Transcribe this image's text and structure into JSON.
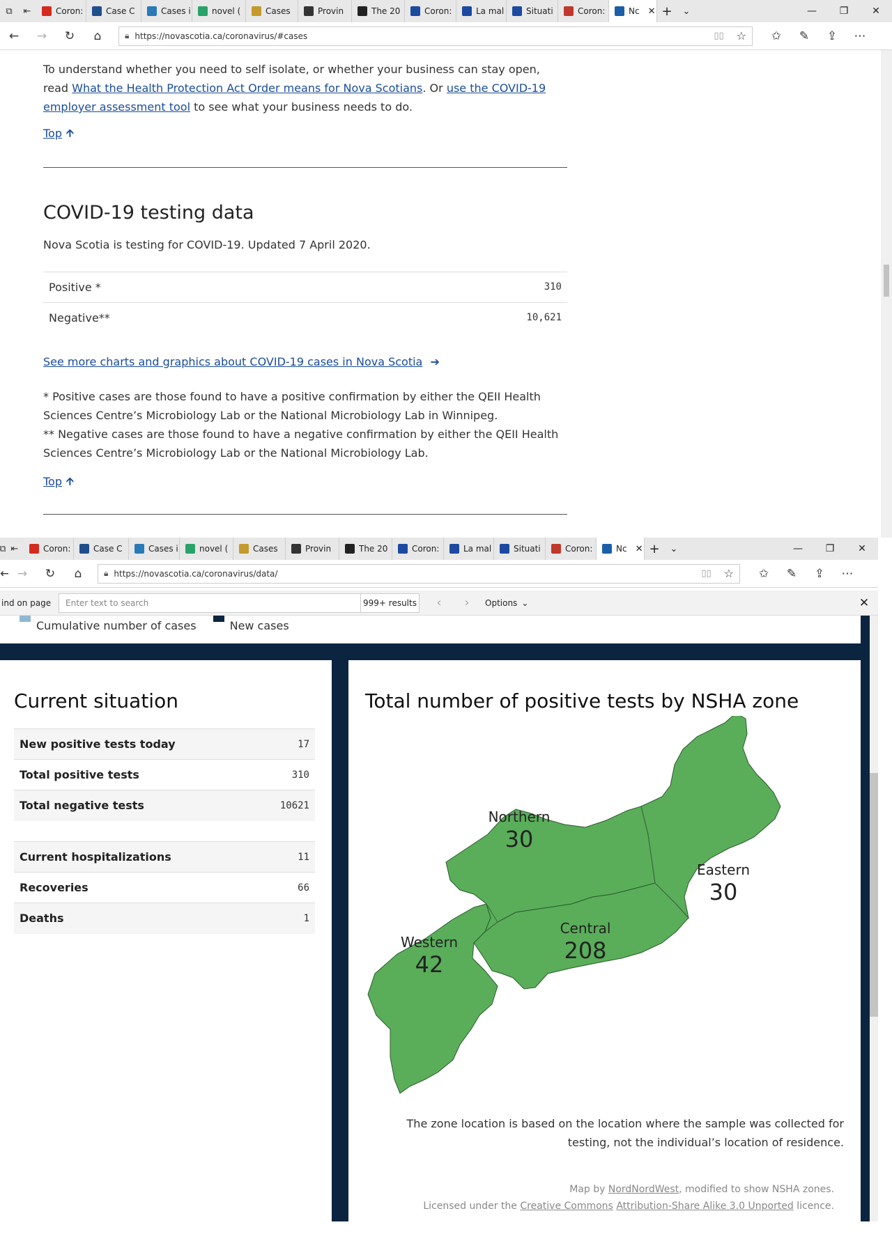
{
  "browser_top": {
    "tabs": [
      {
        "label": "Coron:",
        "icon": "maple-leaf-icon",
        "color": "#d52b1e"
      },
      {
        "label": "Case C",
        "icon": "case-icon",
        "color": "#1f4e8c"
      },
      {
        "label": "Cases i",
        "icon": "chart-icon",
        "color": "#2a7ab8"
      },
      {
        "label": "novel (",
        "icon": "cross-icon",
        "color": "#2aa36b"
      },
      {
        "label": "Cases",
        "icon": "document-icon",
        "color": "#c59a2c"
      },
      {
        "label": "Provin",
        "icon": "car-icon",
        "color": "#333333"
      },
      {
        "label": "The 20",
        "icon": "shield-icon",
        "color": "#222222"
      },
      {
        "label": "Coron:",
        "icon": "quebec-icon",
        "color": "#1c4aa0"
      },
      {
        "label": "La mal",
        "icon": "quebec-icon",
        "color": "#1c4aa0"
      },
      {
        "label": "Situati",
        "icon": "quebec-icon",
        "color": "#1c4aa0"
      },
      {
        "label": "Coron:",
        "icon": "swoosh-icon",
        "color": "#c0392b"
      },
      {
        "label": "Nc",
        "icon": "ns-flag-icon",
        "color": "#1a5fa8",
        "active": true
      }
    ],
    "url": "https://novascotia.ca/coronavirus/#cases"
  },
  "browser_bottom": {
    "tabs": [
      {
        "label": "Coron:",
        "icon": "maple-leaf-icon",
        "color": "#d52b1e"
      },
      {
        "label": "Case C",
        "icon": "case-icon",
        "color": "#1f4e8c"
      },
      {
        "label": "Cases i",
        "icon": "chart-icon",
        "color": "#2a7ab8"
      },
      {
        "label": "novel (",
        "icon": "cross-icon",
        "color": "#2aa36b"
      },
      {
        "label": "Cases",
        "icon": "document-icon",
        "color": "#c59a2c"
      },
      {
        "label": "Provin",
        "icon": "car-icon",
        "color": "#333333"
      },
      {
        "label": "The 20",
        "icon": "shield-icon",
        "color": "#222222"
      },
      {
        "label": "Coron:",
        "icon": "quebec-icon",
        "color": "#1c4aa0"
      },
      {
        "label": "La mal",
        "icon": "quebec-icon",
        "color": "#1c4aa0"
      },
      {
        "label": "Situati",
        "icon": "quebec-icon",
        "color": "#1c4aa0"
      },
      {
        "label": "Coron:",
        "icon": "swoosh-icon",
        "color": "#c0392b"
      },
      {
        "label": "Nc",
        "icon": "ns-chart-icon",
        "color": "#1a5fa8",
        "active": true
      }
    ],
    "url": "https://novascotia.ca/coronavirus/data/"
  },
  "page1": {
    "intro_text_1": "To understand whether you need to self isolate, or whether your business can stay open, read ",
    "intro_link_1": "What the Health Protection Act Order means for Nova Scotians",
    "intro_text_2": ". Or ",
    "intro_link_2": "use the COVID-19 employer assessment tool",
    "intro_text_3": " to see what your business needs to do.",
    "top_label": "Top",
    "section_title": "COVID-19 testing data",
    "section_subtitle": "Nova Scotia is testing for COVID-19. Updated 7 April 2020.",
    "testing_rows": [
      {
        "label": "Positive *",
        "value": "310"
      },
      {
        "label": "Negative**",
        "value": "10,621"
      }
    ],
    "more_link": "See more charts and graphics about COVID-19 cases in Nova Scotia",
    "footnote_1": "* Positive cases are those found to have a positive confirmation by either the QEII Health Sciences Centre’s Microbiology Lab or the National Microbiology Lab in Winnipeg.",
    "footnote_2": "** Negative cases are those found to have a negative confirmation by either the QEII Health Sciences Centre’s Microbiology Lab or the National Microbiology Lab.",
    "top_label_2": "Top"
  },
  "findbar": {
    "label": "ind on page",
    "placeholder": "Enter text to search",
    "results": "999+ results",
    "options": "Options"
  },
  "page2": {
    "legend": [
      {
        "label": "Cumulative number of cases",
        "color": "#8fb8d0"
      },
      {
        "label": "New cases",
        "color": "#0b2440"
      }
    ],
    "situation_title": "Current situation",
    "situation_rows_1": [
      {
        "label": "New positive tests today",
        "value": "17"
      },
      {
        "label": "Total positive tests",
        "value": "310"
      },
      {
        "label": "Total negative tests",
        "value": "10621"
      }
    ],
    "situation_rows_2": [
      {
        "label": "Current hospitalizations",
        "value": "11"
      },
      {
        "label": "Recoveries",
        "value": "66"
      },
      {
        "label": "Deaths",
        "value": "1"
      }
    ],
    "map_title": "Total number of positive tests by NSHA zone",
    "map_color": "#5aae5a",
    "zones": [
      {
        "name": "Northern",
        "value": "30"
      },
      {
        "name": "Eastern",
        "value": "30"
      },
      {
        "name": "Central",
        "value": "208"
      },
      {
        "name": "Western",
        "value": "42"
      }
    ],
    "note": "The zone location is based on the location where the sample was collected for testing, not the individual’s location of residence.",
    "credit_map_by": "Map by ",
    "credit_author": "NordNordWest",
    "credit_modified": ", modified to show NSHA zones.",
    "credit_licensed": "Licensed under the ",
    "credit_cc": "Creative Commons",
    "credit_license_name": "Attribution-Share Alike 3.0 Unported",
    "credit_licence": " licence."
  }
}
